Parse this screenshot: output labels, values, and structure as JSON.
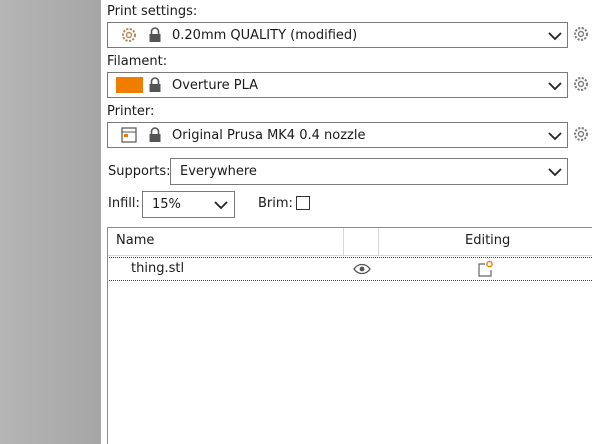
{
  "print_settings": {
    "label": "Print settings:",
    "value": "0.20mm QUALITY (modified)",
    "icons": [
      "gear-icon",
      "lock-icon",
      "chevron-down-icon",
      "gear-icon"
    ]
  },
  "filament": {
    "label": "Filament:",
    "value": "Overture PLA",
    "swatch_color": "#f07d00",
    "icons": [
      "color-swatch",
      "lock-icon",
      "chevron-down-icon",
      "gear-icon"
    ]
  },
  "printer": {
    "label": "Printer:",
    "value": "Original Prusa MK4 0.4 nozzle",
    "icons": [
      "printer-profile-icon",
      "lock-icon",
      "chevron-down-icon",
      "gear-icon"
    ]
  },
  "supports": {
    "label": "Supports:",
    "value": "Everywhere"
  },
  "infill": {
    "label": "Infill:",
    "value": "15%"
  },
  "brim": {
    "label": "Brim:",
    "checked": false
  },
  "object_list": {
    "columns": [
      "Name",
      "",
      "Editing"
    ],
    "rows": [
      {
        "name": "thing.stl",
        "visibility_icon": "eye-icon",
        "editing_icon": "edit-settings-icon"
      }
    ]
  },
  "colors": {
    "accent_orange": "#f07d00",
    "side_panel_gray": "#aaaaaa",
    "border": "#7a7a7a"
  }
}
